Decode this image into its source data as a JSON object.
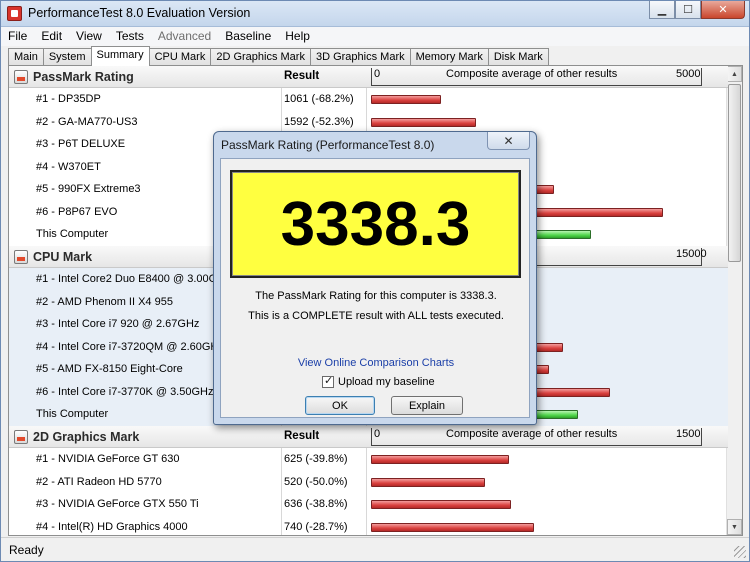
{
  "window": {
    "title": "PerformanceTest 8.0 Evaluation Version"
  },
  "menu": [
    {
      "label": "File",
      "disabled": false
    },
    {
      "label": "Edit",
      "disabled": false
    },
    {
      "label": "View",
      "disabled": false
    },
    {
      "label": "Tests",
      "disabled": false
    },
    {
      "label": "Advanced",
      "disabled": true
    },
    {
      "label": "Baseline",
      "disabled": false
    },
    {
      "label": "Help",
      "disabled": false
    }
  ],
  "tabs": [
    "Main",
    "System",
    "Summary",
    "CPU Mark",
    "2D Graphics Mark",
    "3D Graphics Mark",
    "Memory Mark",
    "Disk Mark"
  ],
  "active_tab": "Summary",
  "sections": [
    {
      "title": "PassMark Rating",
      "result_header": "Result",
      "scale": {
        "min": "0",
        "label": "Composite average of other results",
        "max": "5000",
        "max_value": 5000
      },
      "rows": [
        {
          "name": "#1 - DP35DP",
          "result": "1061 (-68.2%)",
          "value": 1061,
          "kind": "red"
        },
        {
          "name": "#2 - GA-MA770-US3",
          "result": "1592 (-52.3%)",
          "value": 1592,
          "kind": "red"
        },
        {
          "name": "#3 - P6T DELUXE",
          "result": "",
          "value": 0,
          "kind": "red"
        },
        {
          "name": "#4 - W370ET",
          "result": "",
          "value": 0,
          "kind": "red"
        },
        {
          "name": "#5 - 990FX Extreme3",
          "result": "",
          "value": 2770,
          "kind": "red"
        },
        {
          "name": "#6 - P8P67 EVO",
          "result": "",
          "value": 4430,
          "kind": "red"
        },
        {
          "name": "This Computer",
          "result": "",
          "value": 3338.3,
          "kind": "green"
        }
      ]
    },
    {
      "title": "CPU Mark",
      "result_header": "",
      "scale": {
        "min": "",
        "label": "e of other results",
        "max": "15000",
        "max_value": 15000
      },
      "rows": [
        {
          "name": "#1 - Intel Core2 Duo E8400 @ 3.00GHz",
          "result": "",
          "value": 0,
          "kind": "red"
        },
        {
          "name": "#2 - AMD Phenom II X4 955",
          "result": "",
          "value": 0,
          "kind": "red"
        },
        {
          "name": "#3 - Intel Core i7 920 @ 2.67GHz",
          "result": "",
          "value": 0,
          "kind": "red"
        },
        {
          "name": "#4 - Intel Core i7-3720QM @ 2.60GHz",
          "result": "",
          "value": 8740,
          "kind": "red"
        },
        {
          "name": "#5 - AMD FX-8150 Eight-Core",
          "result": "",
          "value": 8100,
          "kind": "red"
        },
        {
          "name": "#6 - Intel Core i7-3770K @ 3.50GHz",
          "result": "",
          "value": 10870,
          "kind": "red"
        },
        {
          "name": "This Computer",
          "result": "",
          "value": 9400,
          "kind": "green"
        }
      ]
    },
    {
      "title": "2D Graphics Mark",
      "result_header": "Result",
      "scale": {
        "min": "0",
        "label": "Composite average of other results",
        "max": "1500",
        "max_value": 1500
      },
      "rows": [
        {
          "name": "#1 - NVIDIA GeForce GT 630",
          "result": "625 (-39.8%)",
          "value": 625,
          "kind": "red"
        },
        {
          "name": "#2 - ATI Radeon HD 5770",
          "result": "520 (-50.0%)",
          "value": 520,
          "kind": "red"
        },
        {
          "name": "#3 - NVIDIA GeForce GTX 550 Ti",
          "result": "636 (-38.8%)",
          "value": 636,
          "kind": "red"
        },
        {
          "name": "#4 - Intel(R) HD Graphics 4000",
          "result": "740 (-28.7%)",
          "value": 740,
          "kind": "red"
        }
      ]
    }
  ],
  "status": "Ready",
  "dialog": {
    "title": "PassMark Rating (PerformanceTest 8.0)",
    "close_label": "✕",
    "score": "3338.3",
    "line1": "The PassMark Rating for this computer is 3338.3.",
    "line2": "This is a COMPLETE result with ALL tests executed.",
    "link": "View Online Comparison Charts",
    "checkbox_label": "Upload my baseline",
    "checkbox_checked": true,
    "ok_label": "OK",
    "explain_label": "Explain"
  },
  "icons": {
    "app": "performancetest-app-icon",
    "section": "benchmark-section-icon",
    "minimize": "minimize-icon",
    "maximize": "maximize-icon",
    "close": "close-icon"
  }
}
